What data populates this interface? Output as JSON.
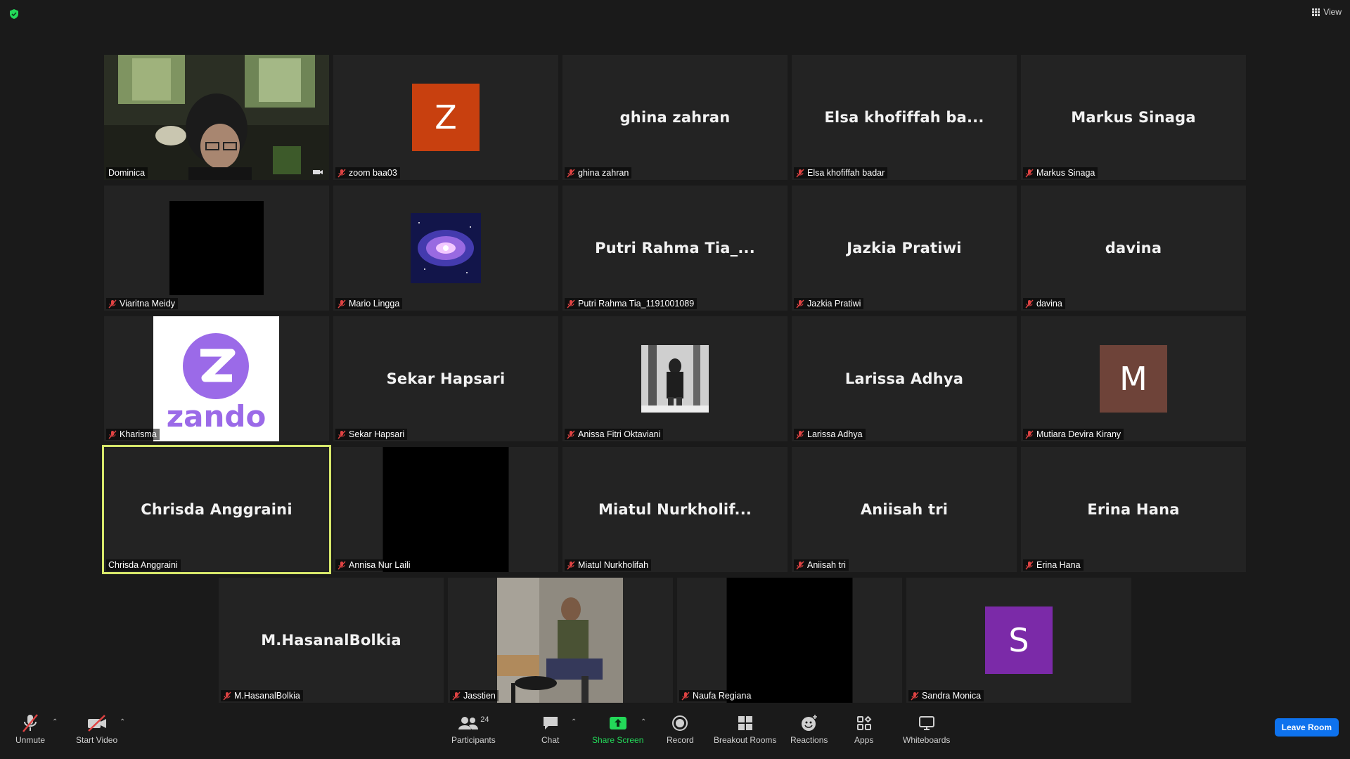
{
  "top": {
    "view_label": "View"
  },
  "tiles": [
    {
      "display_name": "",
      "label": "Dominica"
    },
    {
      "display_name": "",
      "label": "zoom baa03",
      "avatar_letter": "Z",
      "avatar_color": "#c8400f"
    },
    {
      "display_name": "ghina zahran",
      "label": "ghina zahran"
    },
    {
      "display_name": "Elsa  khofiffah  ba...",
      "label": "Elsa khofiffah badar"
    },
    {
      "display_name": "Markus Sinaga",
      "label": "Markus Sinaga"
    },
    {
      "display_name": "",
      "label": "Viaritna Meidy"
    },
    {
      "display_name": "",
      "label": "Mario Lingga"
    },
    {
      "display_name": "Putri  Rahma  Tia_...",
      "label": "Putri Rahma Tia_1191001089"
    },
    {
      "display_name": "Jazkia Pratiwi",
      "label": "Jazkia Pratiwi"
    },
    {
      "display_name": "davina",
      "label": "davina"
    },
    {
      "display_name": "",
      "label": "Kharisma",
      "logo_text": "zando"
    },
    {
      "display_name": "Sekar Hapsari",
      "label": "Sekar Hapsari"
    },
    {
      "display_name": "",
      "label": "Anissa Fitri Oktaviani"
    },
    {
      "display_name": "Larissa Adhya",
      "label": "Larissa Adhya"
    },
    {
      "display_name": "",
      "label": "Mutiara Devira Kirany",
      "avatar_letter": "M",
      "avatar_color": "#6e4339"
    },
    {
      "display_name": "Chrisda Anggraini",
      "label": "Chrisda Anggraini"
    },
    {
      "display_name": "",
      "label": "Annisa Nur Laili"
    },
    {
      "display_name": "Miatul  Nurkholif...",
      "label": "Miatul Nurkholifah"
    },
    {
      "display_name": "Aniisah tri",
      "label": "Aniisah tri"
    },
    {
      "display_name": "Erina Hana",
      "label": "Erina Hana"
    },
    {
      "display_name": "M.HasanalBolkia",
      "label": "M.HasanalBolkia"
    },
    {
      "display_name": "",
      "label": "Jasstien"
    },
    {
      "display_name": "",
      "label": "Naufa Regiana"
    },
    {
      "display_name": "",
      "label": "Sandra Monica",
      "avatar_letter": "S",
      "avatar_color": "#7b2aa8"
    }
  ],
  "toolbar": {
    "unmute": "Unmute",
    "start_video": "Start Video",
    "participants": "Participants",
    "participants_count": "24",
    "chat": "Chat",
    "share_screen": "Share Screen",
    "record": "Record",
    "breakout_rooms": "Breakout Rooms",
    "reactions": "Reactions",
    "apps": "Apps",
    "whiteboards": "Whiteboards",
    "leave_room": "Leave Room"
  },
  "colors": {
    "active_speaker": "#d7e86b",
    "share_green": "#23d959",
    "leave_blue": "#0e72ed"
  }
}
